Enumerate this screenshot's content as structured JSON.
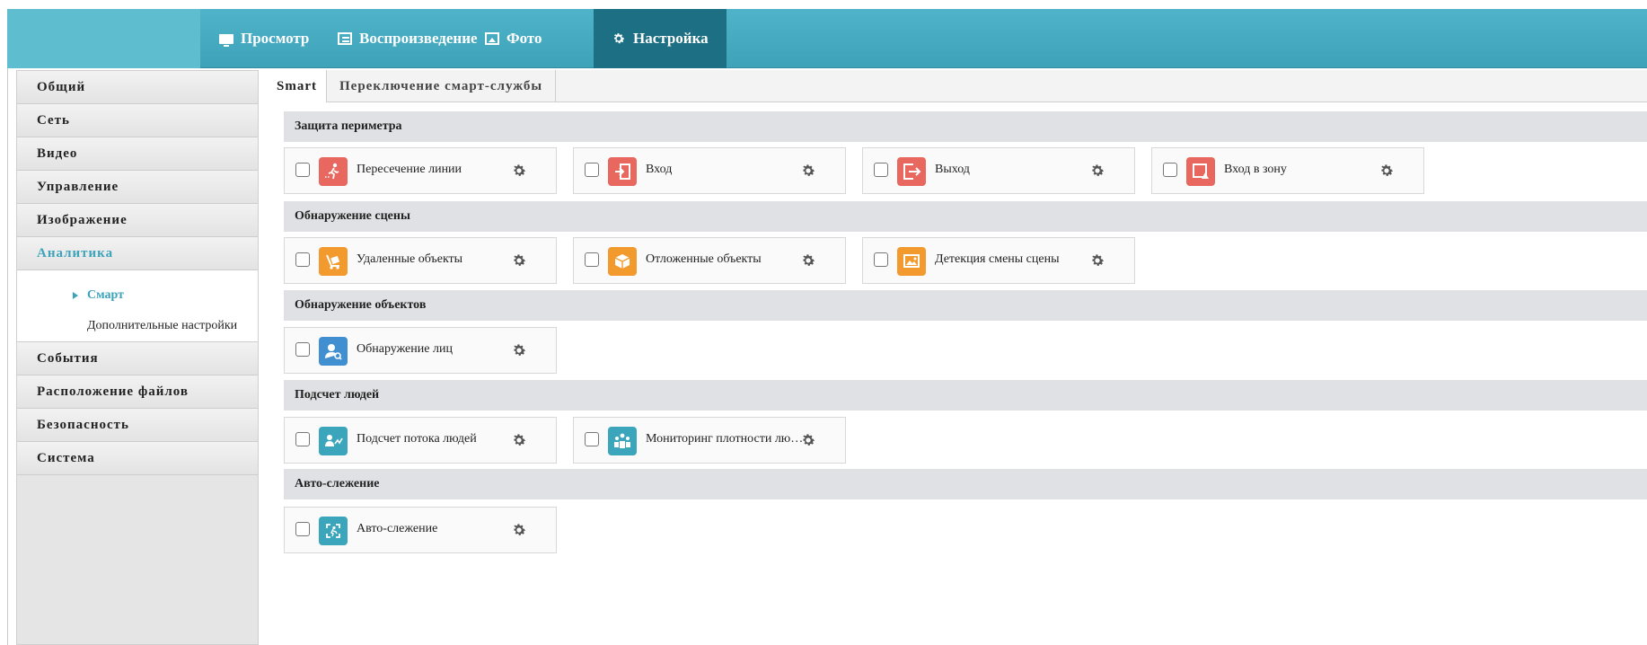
{
  "topnav": {
    "items": [
      {
        "label": "Просмотр",
        "icon": "monitor-icon"
      },
      {
        "label": "Воспроизведение",
        "icon": "playback-icon"
      },
      {
        "label": "Фото",
        "icon": "photo-icon"
      },
      {
        "label": "Настройка",
        "icon": "gear-icon",
        "active": true
      }
    ]
  },
  "sidebar": {
    "items": [
      {
        "label": "Общий"
      },
      {
        "label": "Сеть"
      },
      {
        "label": "Видео"
      },
      {
        "label": "Управление"
      },
      {
        "label": "Изображение"
      },
      {
        "label": "Аналитика",
        "active": true
      },
      {
        "label": "События"
      },
      {
        "label": "Расположение файлов"
      },
      {
        "label": "Безопасность"
      },
      {
        "label": "Система"
      }
    ],
    "sub_items": [
      {
        "label": "Смарт",
        "active": true
      },
      {
        "label": "Дополнительные настройки"
      }
    ]
  },
  "tabs": [
    {
      "label": "Smart",
      "active": true
    },
    {
      "label": "Переключение смарт-службы"
    }
  ],
  "sections": [
    {
      "title": "Защита периметра",
      "cards": [
        {
          "label": "Пересечение линии",
          "icon": "line-crossing-icon",
          "color": "#e8675f",
          "checked": false
        },
        {
          "label": "Вход",
          "icon": "enter-icon",
          "color": "#e8675f",
          "checked": false
        },
        {
          "label": "Выход",
          "icon": "exit-icon",
          "color": "#e8675f",
          "checked": false
        },
        {
          "label": "Вход в зону",
          "icon": "zone-entry-icon",
          "color": "#e8675f",
          "checked": false
        }
      ]
    },
    {
      "title": "Обнаружение сцены",
      "cards": [
        {
          "label": "Удаленные объекты",
          "icon": "removed-objects-icon",
          "color": "#f29a2e",
          "checked": false
        },
        {
          "label": "Отложенные объекты",
          "icon": "left-objects-icon",
          "color": "#f29a2e",
          "checked": false
        },
        {
          "label": "Детекция смены сцены",
          "icon": "scene-change-icon",
          "color": "#f29a2e",
          "checked": false
        }
      ]
    },
    {
      "title": "Обнаружение объектов",
      "cards": [
        {
          "label": "Обнаружение лиц",
          "icon": "face-detection-icon",
          "color": "#3f8fd1",
          "checked": false
        }
      ]
    },
    {
      "title": "Подсчет людей",
      "cards": [
        {
          "label": "Подсчет потока людей",
          "icon": "people-counting-icon",
          "color": "#3aa5bb",
          "checked": false
        },
        {
          "label": "Мониторинг плотности лю…",
          "icon": "crowd-density-icon",
          "color": "#3aa5bb",
          "checked": false
        }
      ]
    },
    {
      "title": "Авто-слежение",
      "cards": [
        {
          "label": "Авто-слежение",
          "icon": "auto-tracking-icon",
          "color": "#3aa5bb",
          "checked": false
        }
      ]
    }
  ]
}
